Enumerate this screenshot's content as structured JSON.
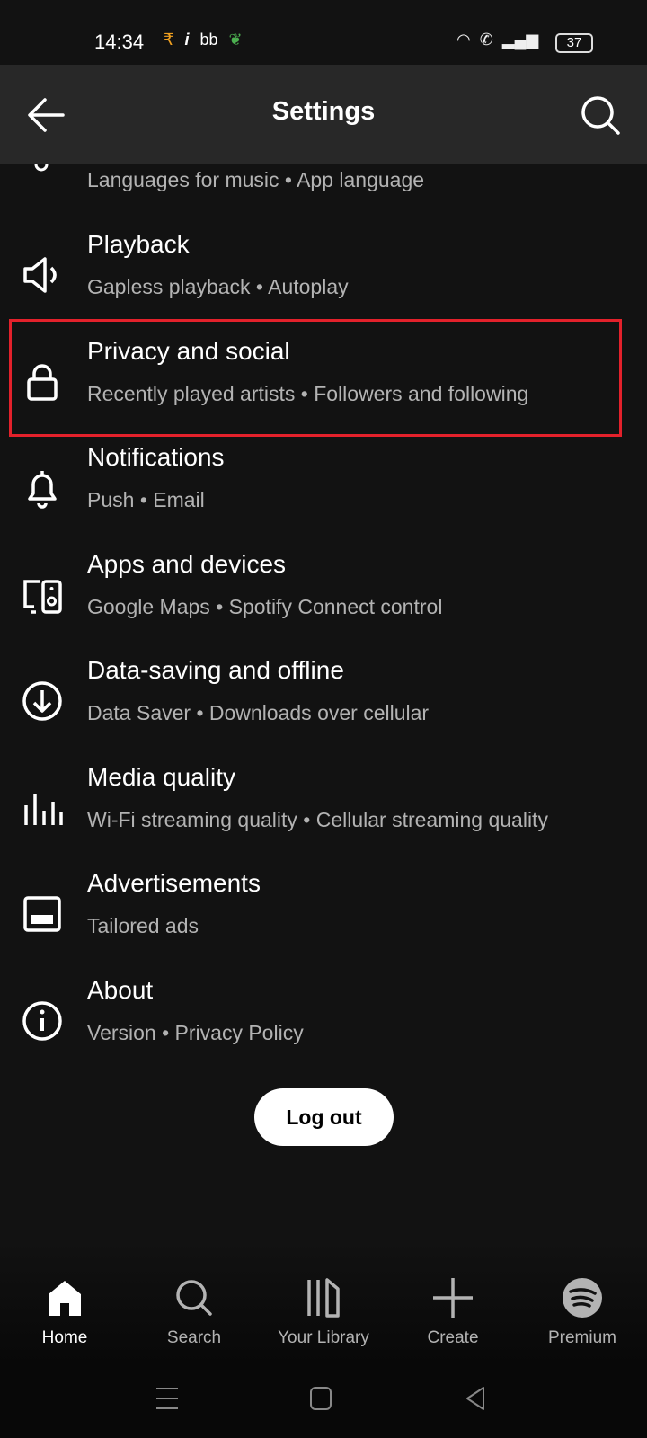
{
  "status_bar": {
    "time": "14:34",
    "battery": "37"
  },
  "header": {
    "title": "Settings"
  },
  "partial_item": {
    "subtitle": "Languages for music • App language"
  },
  "items": [
    {
      "title": "Playback",
      "subtitle": "Gapless playback • Autoplay",
      "icon": "speaker-icon"
    },
    {
      "title": "Privacy and social",
      "subtitle": "Recently played artists • Followers and following",
      "icon": "lock-icon",
      "highlighted": true
    },
    {
      "title": "Notifications",
      "subtitle": "Push • Email",
      "icon": "bell-icon"
    },
    {
      "title": "Apps and devices",
      "subtitle": "Google Maps • Spotify Connect control",
      "icon": "devices-icon"
    },
    {
      "title": "Data-saving and offline",
      "subtitle": "Data Saver • Downloads over cellular",
      "icon": "download-icon"
    },
    {
      "title": "Media quality",
      "subtitle": "Wi-Fi streaming quality • Cellular streaming quality",
      "icon": "equalizer-icon"
    },
    {
      "title": "Advertisements",
      "subtitle": "Tailored ads",
      "icon": "ad-icon"
    },
    {
      "title": "About",
      "subtitle": "Version • Privacy Policy",
      "icon": "info-icon"
    }
  ],
  "logout_label": "Log out",
  "bottom_nav": [
    {
      "label": "Home",
      "active": true
    },
    {
      "label": "Search"
    },
    {
      "label": "Your Library"
    },
    {
      "label": "Create"
    },
    {
      "label": "Premium"
    }
  ],
  "colors": {
    "highlight": "#e3212b",
    "background": "#121212",
    "header": "#282828"
  }
}
